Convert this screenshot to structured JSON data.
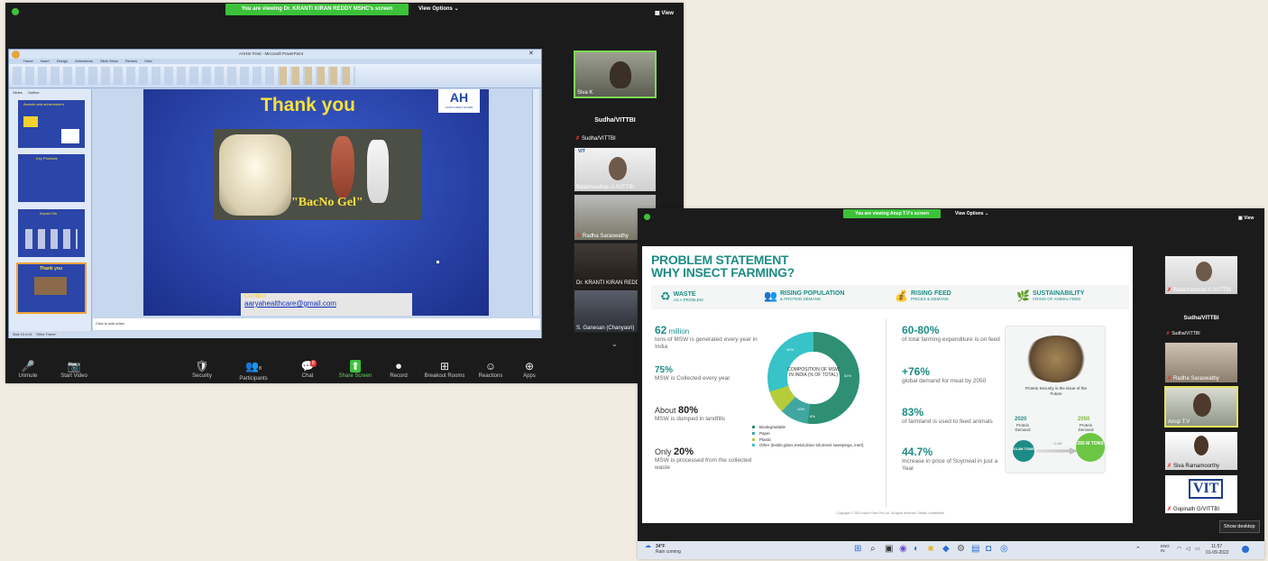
{
  "meeting1": {
    "banner": "You are viewing Dr. KRANTI KIRAN REDDY MSHC's screen",
    "view_options": "View Options ⌄",
    "view": "View",
    "ppt": {
      "title": "AAHSI Final - Microsoft PowerPoint",
      "tabs": [
        "Home",
        "Insert",
        "Design",
        "Animations",
        "Slide Show",
        "Review",
        "View"
      ],
      "panel_tabs": [
        "Slides",
        "Outline"
      ],
      "thumb_titles": [
        "Awards and achievement",
        "Key Products",
        "Impact Stn",
        "Thank you"
      ],
      "slide": {
        "title": "Thank you",
        "logo": "AH",
        "logo_sub": "AARYA HEALTHCARE",
        "product_label": "\"BacNo Gel\"",
        "contact_label": "Contact",
        "contact_email": "aaryahealthcare@gmail.com"
      },
      "notes": "Click to add notes",
      "status": "Slide 15 of 15    \"Office Theme\""
    },
    "participants": [
      {
        "name": "Siva K"
      },
      {
        "name": "Sudha/VITTBI",
        "header": true
      },
      {
        "name": "Sudha/VITTBI"
      },
      {
        "name": "Balachandran A /VITTBI",
        "logo": "VIT"
      },
      {
        "name": "Radha Saraswathy"
      },
      {
        "name": "Dr. KRANTI KIRAN REDDY"
      },
      {
        "name": "S. Ganesan (Chanyasri)"
      }
    ],
    "toolbar": [
      {
        "label": "Unmute",
        "icon": "🎤"
      },
      {
        "label": "Start Video",
        "icon": "📷"
      },
      {
        "label": "Security",
        "icon": "🛡"
      },
      {
        "label": "Participants",
        "icon": "👥",
        "count": "8"
      },
      {
        "label": "Chat",
        "icon": "💬",
        "badge": "8"
      },
      {
        "label": "Share Screen",
        "icon": "⬆"
      },
      {
        "label": "Record",
        "icon": "⏺"
      },
      {
        "label": "Breakout Rooms",
        "icon": "⊞"
      },
      {
        "label": "Reactions",
        "icon": "☺"
      },
      {
        "label": "Apps",
        "icon": "⊕"
      }
    ]
  },
  "meeting2": {
    "banner": "You are viewing Anup T.V's screen",
    "view_options": "View Options ⌄",
    "view": "View",
    "slide": {
      "title1": "PROBLEM STATEMENT",
      "title2": "WHY INSECT FARMING?",
      "headers": [
        {
          "t": "WASTE",
          "s": "AS A PROBLEM",
          "icon": "♻"
        },
        {
          "t": "RISING POPULATION",
          "s": "& PROTEIN DEMAND",
          "icon": "👥"
        },
        {
          "t": "RISING FEED",
          "s": "PRICES & DEMAND",
          "icon": "💰"
        },
        {
          "t": "SUSTAINABILITY",
          "s": "CRISIS OF ANIMAL FEED",
          "icon": "🌿"
        }
      ],
      "left_stats": [
        {
          "big": "62",
          "big_unit": " million",
          "desc": "tons of MSW is generated every year in India"
        },
        {
          "big": "75%",
          "desc": "MSW is Collected every year"
        },
        {
          "prefix": "About ",
          "big": "80%",
          "desc": "MSW is dumped in landfills"
        },
        {
          "prefix": "Only ",
          "big": "20%",
          "desc": "MSW is processed from the collected waste"
        }
      ],
      "donut_label": "COMPOSITION OF MSW IN INDIA (% OF TOTAL)",
      "donut_values": [
        "52%",
        "10%",
        "8%",
        "30%"
      ],
      "legend": [
        {
          "label": "Biodegradable",
          "color": "#2e8f72"
        },
        {
          "label": "Paper",
          "color": "#3fa7a0"
        },
        {
          "label": "Plastic",
          "color": "#b5cc3a"
        },
        {
          "label": "Other (textile,glass,metal,drain silt,street sweepings, inert)",
          "color": "#37c3c7"
        }
      ],
      "right_stats": [
        {
          "big": "60-80%",
          "desc": "of total farming expenditure is on feed"
        },
        {
          "big": "+76%",
          "desc": "global demand for meat by 2050"
        },
        {
          "big": "83%",
          "desc": "of farmland is used to feed animals"
        },
        {
          "big": "44.7%",
          "desc": "Increase in price of Soymeal in just a Year"
        }
      ],
      "protein_text": "Protein Security is the issue of the Future",
      "y2020": "2020",
      "y2050": "2050",
      "protein_demand": "Protein Demand",
      "v2020": "63.3M TONS",
      "v2050": "265 M TONS",
      "arrow_label": "~2.4X",
      "footer": "Copyright © 2022 Insect Farm Pvt Ltd. All rights reserved. Strictly confidential"
    },
    "participants": [
      {
        "name": "Balachandran A /VITTBI"
      },
      {
        "name": "Sudha/VITTBI",
        "header": true
      },
      {
        "name": "Sudha/VITTBI"
      },
      {
        "name": "Radha Saraswathy"
      },
      {
        "name": "Anup T.V"
      },
      {
        "name": "Siva Ramamoorthy"
      },
      {
        "name": "Gopinath G/VITTBI",
        "logo": "VIT"
      }
    ],
    "show_desktop": "Show desktop",
    "taskbar": {
      "weather_temp": "34°F",
      "weather_text": "Rain coming",
      "lang": "ENG\nIN",
      "time": "11:57",
      "date": "01-09-2022"
    }
  },
  "colors": {
    "zoom_green": "#3cc23a",
    "accent_teal": "#1d8c86",
    "slide_blue": "#2b45a8",
    "ppt_bg": "#c7d7ee"
  }
}
